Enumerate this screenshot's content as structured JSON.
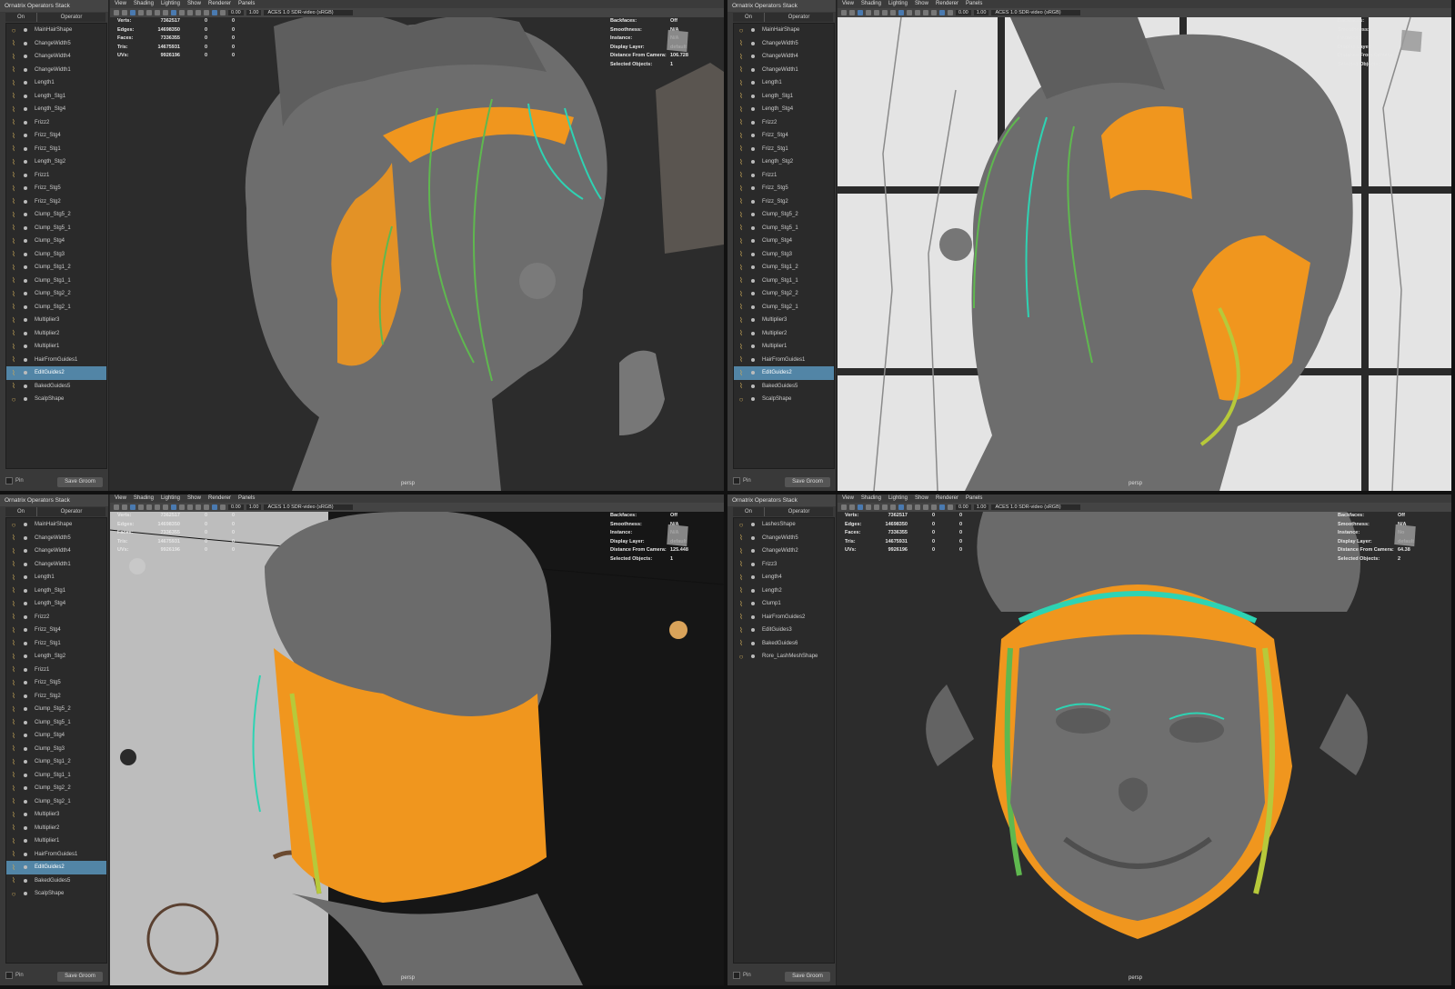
{
  "panel": {
    "title": "Ornatrix Operators Stack",
    "col_on": "On",
    "col_operator": "Operator",
    "pin_label": "Pin",
    "save_label": "Save Groom"
  },
  "stack_main": [
    "MainHairShape",
    "ChangeWidth5",
    "ChangeWidth4",
    "ChangeWidth1",
    "Length1",
    "Length_Stg1",
    "Length_Stg4",
    "Frizz2",
    "Frizz_Stg4",
    "Frizz_Stg1",
    "Length_Stg2",
    "Frizz1",
    "Frizz_Stg5",
    "Frizz_Stg2",
    "Clump_Stg5_2",
    "Clump_Stg5_1",
    "Clump_Stg4",
    "Clump_Stg3",
    "Clump_Stg1_2",
    "Clump_Stg1_1",
    "Clump_Stg2_2",
    "Clump_Stg2_1",
    "Multiplier3",
    "Multiplier2",
    "Multiplier1",
    "HairFromGuides1",
    "EditGuides2",
    "BakedGuides5",
    "ScalpShape"
  ],
  "stack_lashes": [
    "LashesShape",
    "ChangeWidth5",
    "ChangeWidth2",
    "Frizz3",
    "Length4",
    "Length2",
    "Clump1",
    "HairFromGuides2",
    "EditGuides3",
    "BakedGuides6",
    "Rore_LashMeshShape"
  ],
  "selected": {
    "main": "EditGuides2",
    "lashes": ""
  },
  "viewport": {
    "menus": [
      "View",
      "Shading",
      "Lighting",
      "Show",
      "Renderer",
      "Panels"
    ],
    "gamma": "0.00",
    "exposure": "1.00",
    "color_space": "ACES 1.0 SDR-video (sRGB)",
    "camera": "persp"
  },
  "hud_left": {
    "labels": [
      "Verts:",
      "Edges:",
      "Faces:",
      "Tris:",
      "UVs:"
    ],
    "values": [
      "7362517",
      "14698350",
      "7336355",
      "14675931",
      "9926196"
    ],
    "zeros": [
      "0",
      "0",
      "0",
      "0",
      "0"
    ]
  },
  "hud_right_labels": [
    "Backfaces:",
    "Smoothness:",
    "Instance:",
    "Display Layer:",
    "Distance From Camera:",
    "Selected Objects:"
  ],
  "views": [
    {
      "hud_right_values": [
        "Off",
        "N/A",
        "N/A",
        "default",
        "106.728",
        "1"
      ]
    },
    {
      "hud_right_values": [
        "",
        "",
        "",
        "",
        "",
        ""
      ]
    },
    {
      "hud_right_values": [
        "Off",
        "N/A",
        "N/A",
        "default",
        "125.448",
        "1"
      ]
    },
    {
      "hud_right_values": [
        "Off",
        "N/A",
        "No",
        "default",
        "64.38",
        "2"
      ]
    }
  ],
  "colors": {
    "hair_orange": "#f0961e",
    "guide_teal": "#2ed3b3",
    "guide_green": "#5fb84f",
    "sculpt_gray": "#6d6d6d",
    "selection_blue": "#5285a6"
  }
}
